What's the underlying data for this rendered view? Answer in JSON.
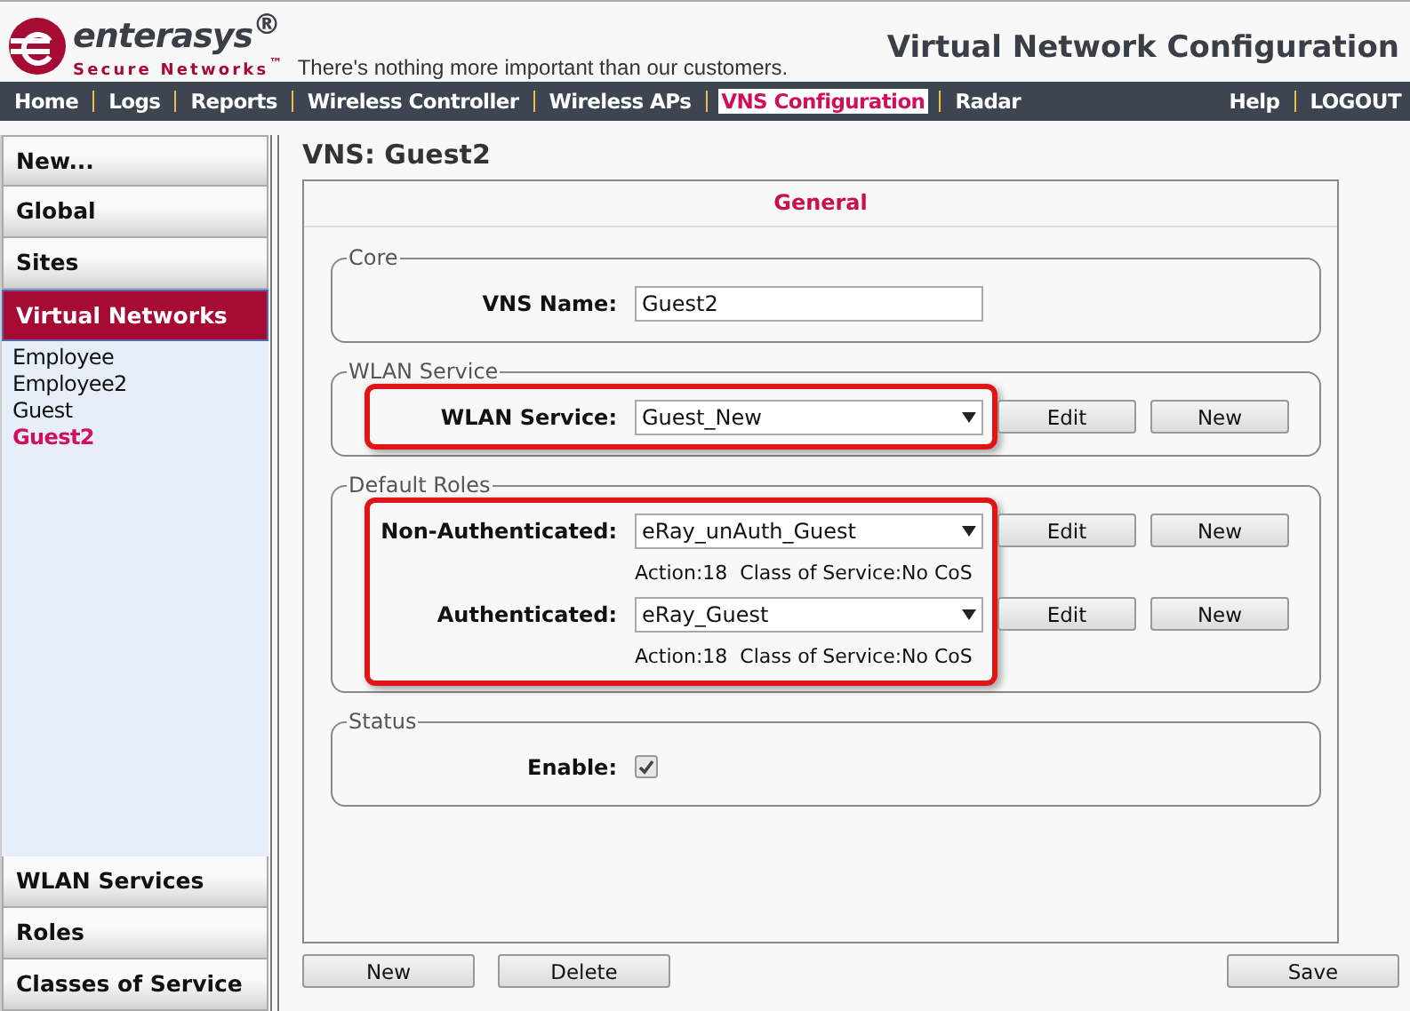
{
  "header": {
    "logo": {
      "name": "enterasys$^{®}$",
      "sub": "Secure Networks$^{™}$"
    },
    "tagline": "There's nothing more important than our customers.",
    "title": "Virtual Network Configuration"
  },
  "nav": {
    "items": [
      {
        "label": "Home",
        "selected": false
      },
      {
        "label": "Logs",
        "selected": false
      },
      {
        "label": "Reports",
        "selected": false
      },
      {
        "label": "Wireless Controller",
        "selected": false
      },
      {
        "label": "Wireless APs",
        "selected": false
      },
      {
        "label": "VNS Configuration",
        "selected": true
      },
      {
        "label": "Radar",
        "selected": false
      }
    ],
    "right": [
      "Help",
      "LOGOUT"
    ]
  },
  "sidebar": {
    "top": [
      {
        "label": "New...",
        "selected": false
      },
      {
        "label": "Global",
        "selected": false
      },
      {
        "label": "Sites",
        "selected": false
      },
      {
        "label": "Virtual Networks",
        "selected": true
      }
    ],
    "children": [
      {
        "label": "Employee",
        "selected": false
      },
      {
        "label": "Employee2",
        "selected": false
      },
      {
        "label": "Guest",
        "selected": false
      },
      {
        "label": "Guest2",
        "selected": true
      }
    ],
    "bottom": [
      {
        "label": "WLAN Services",
        "selected": false
      },
      {
        "label": "Roles",
        "selected": false
      },
      {
        "label": "Classes of Service",
        "selected": false
      }
    ]
  },
  "page": {
    "title": "VNS: Guest2",
    "tab": "General",
    "sections": [
      {
        "legend": "Core",
        "highlighted": false,
        "rows": [
          {
            "kind": "text",
            "label": "VNS Name:",
            "value": "Guest2"
          }
        ]
      },
      {
        "legend": "WLAN Service",
        "highlighted": true,
        "rows": [
          {
            "kind": "select",
            "label": "WLAN Service:",
            "value": "Guest_New",
            "buttons": [
              "Edit",
              "New"
            ]
          }
        ]
      },
      {
        "legend": "Default Roles",
        "highlighted": true,
        "rows": [
          {
            "kind": "select",
            "label": "Non-Authenticated:",
            "value": "eRay_unAuth_Guest",
            "info": "Action:18  Class of Service:No CoS",
            "buttons": [
              "Edit",
              "New"
            ]
          },
          {
            "kind": "select",
            "label": "Authenticated:",
            "value": "eRay_Guest",
            "info": "Action:18  Class of Service:No CoS",
            "buttons": [
              "Edit",
              "New"
            ]
          }
        ]
      },
      {
        "legend": "Status",
        "highlighted": false,
        "rows": [
          {
            "kind": "checkbox",
            "label": "Enable:",
            "checked": true
          }
        ]
      }
    ],
    "buttons_left": [
      "New",
      "Delete"
    ],
    "buttons_right": [
      "Save"
    ]
  }
}
